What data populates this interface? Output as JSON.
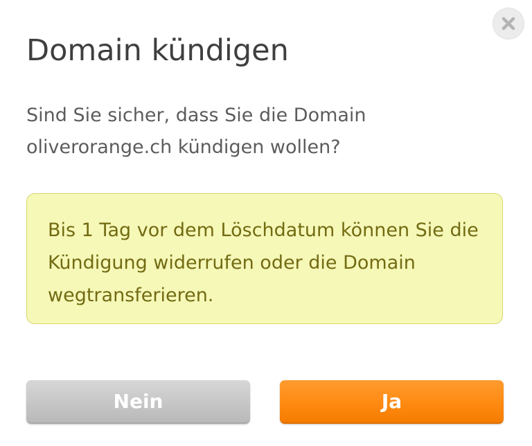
{
  "dialog": {
    "title": "Domain kündigen",
    "question": "Sind Sie sicher, dass Sie die Domain oliverorange.ch kündigen wollen?",
    "notice": "Bis 1 Tag vor dem Löschdatum können Sie die Kündigung widerrufen oder die Domain wegtransferieren.",
    "close_icon": "close-icon",
    "buttons": {
      "no_label": "Nein",
      "yes_label": "Ja"
    }
  },
  "colors": {
    "title_text": "#3f3f3f",
    "body_text": "#5c5c5c",
    "notice_background": "#f6f8b8",
    "notice_border": "#d8d66a",
    "notice_text": "#726b12",
    "button_no": "#c6c6c6",
    "button_yes": "#ff8a12"
  }
}
